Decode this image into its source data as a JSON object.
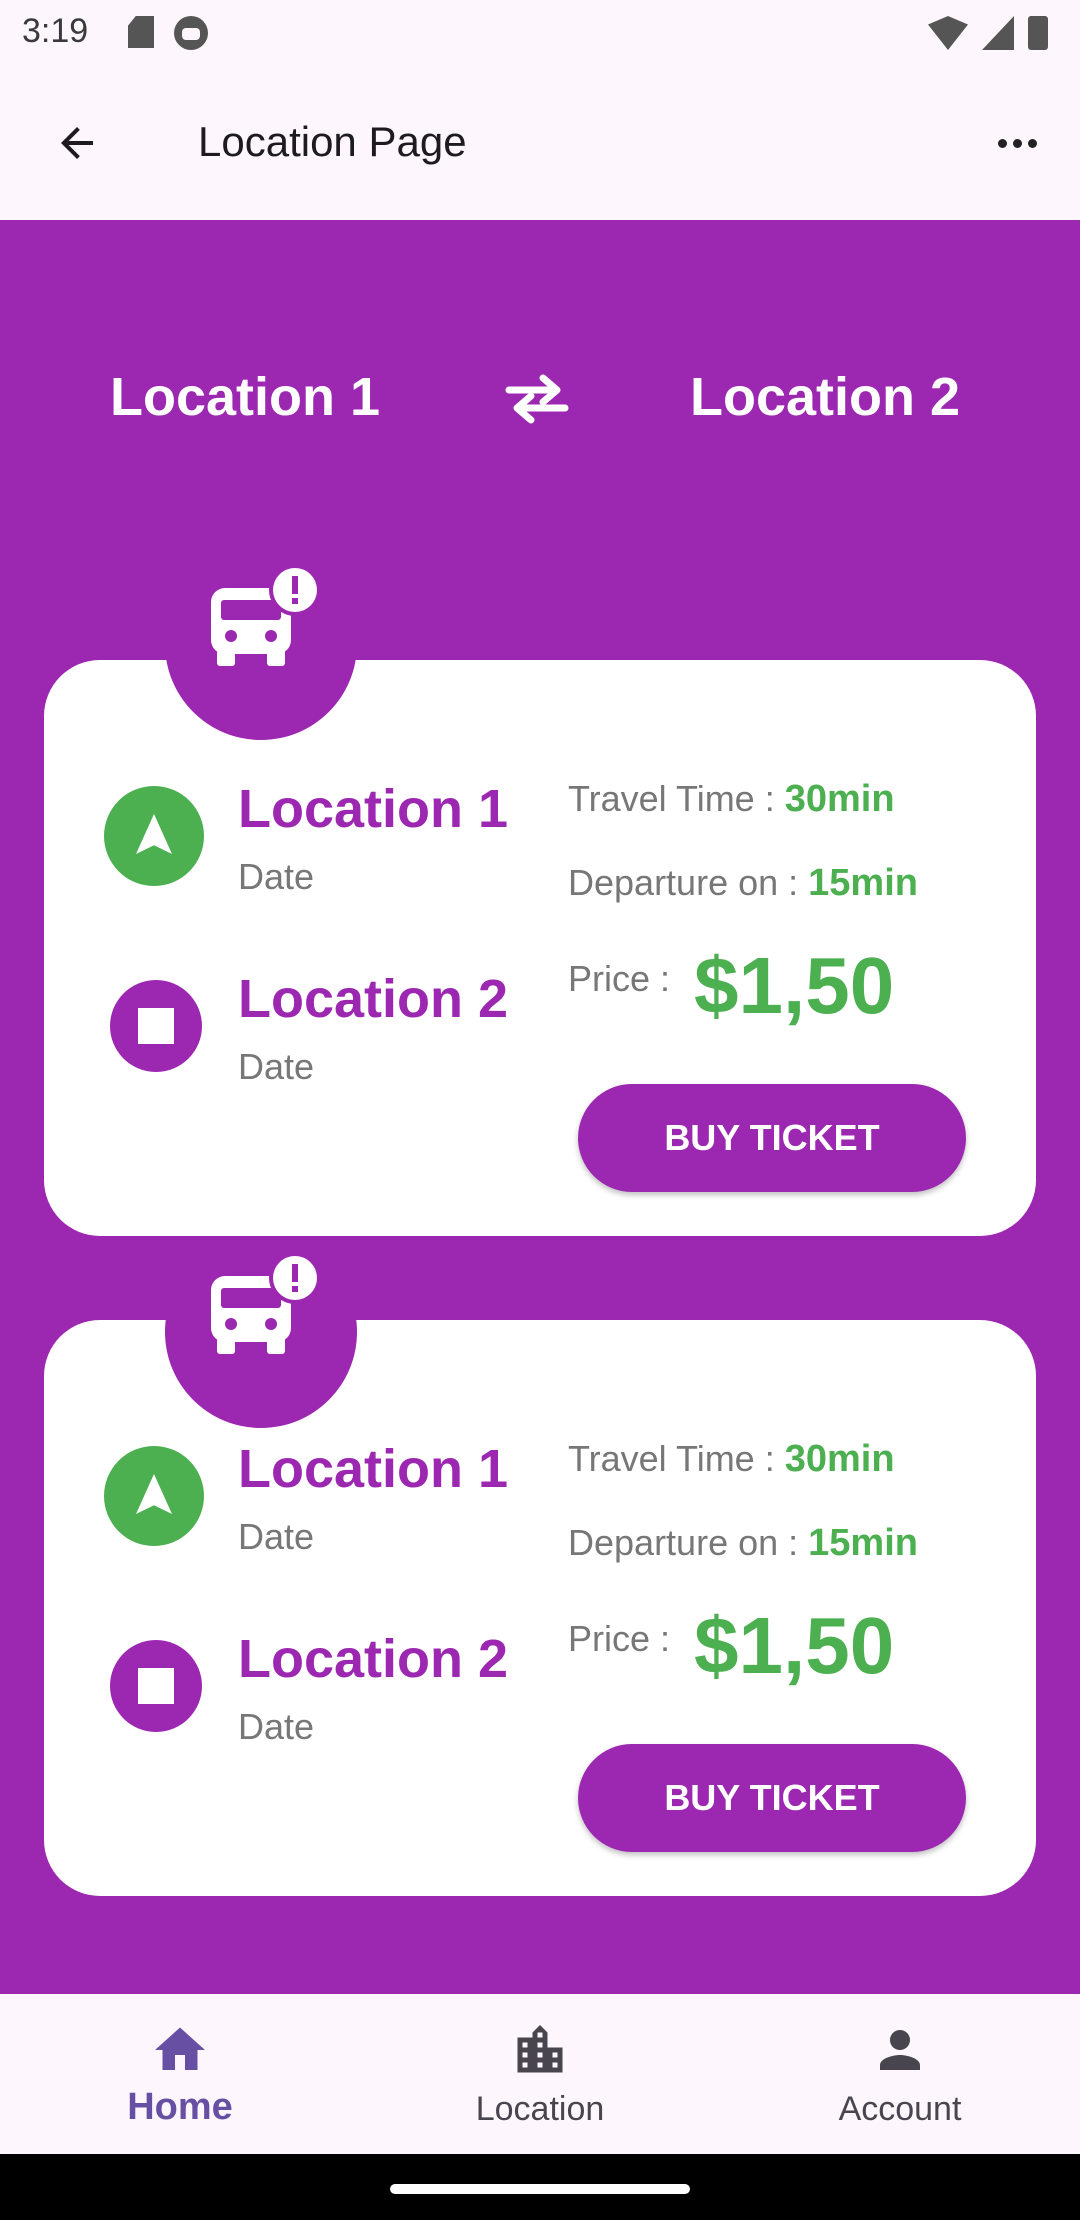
{
  "status_bar": {
    "time": "3:19"
  },
  "app_bar": {
    "title": "Location Page"
  },
  "route": {
    "from": "Location 1",
    "to": "Location 2"
  },
  "trips": [
    {
      "start_name": "Location 1",
      "start_date": "Date",
      "end_name": "Location 2",
      "end_date": "Date",
      "travel_label": "Travel Time :",
      "travel_value": "30min",
      "departure_label": "Departure on :",
      "departure_value": "15min",
      "price_label": "Price :",
      "price_value": "$1,50",
      "button_label": "BUY TICKET"
    },
    {
      "start_name": "Location 1",
      "start_date": "Date",
      "end_name": "Location 2",
      "end_date": "Date",
      "travel_label": "Travel Time :",
      "travel_value": "30min",
      "departure_label": "Departure on :",
      "departure_value": "15min",
      "price_label": "Price :",
      "price_value": "$1,50",
      "button_label": "BUY TICKET"
    }
  ],
  "bottom_nav": {
    "items": [
      {
        "label": "Home",
        "icon": "home-icon",
        "active": true
      },
      {
        "label": "Location",
        "icon": "city-icon",
        "active": false
      },
      {
        "label": "Account",
        "icon": "person-icon",
        "active": false
      }
    ]
  },
  "colors": {
    "primary": "#9c27b0",
    "accent_green": "#4caf50",
    "nav_active": "#6750a4"
  }
}
